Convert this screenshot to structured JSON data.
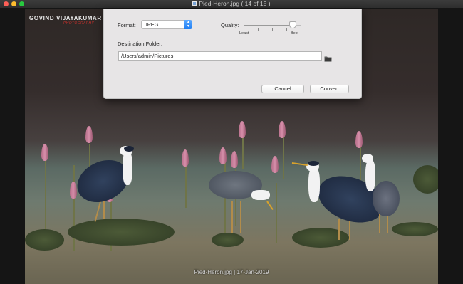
{
  "window": {
    "title": "Pied-Heron.jpg ( 14 of 15 )",
    "file_icon": "document-icon"
  },
  "photo": {
    "watermark_name": "GOVIND VIJAYAKUMAR",
    "watermark_sub": "PHOTOGRAPHY",
    "caption": "Pied-Heron.jpg | 17-Jan-2019"
  },
  "dialog": {
    "format_label": "Format:",
    "format_value": "JPEG",
    "quality_label": "Quality:",
    "quality_min_label": "Least",
    "quality_max_label": "Best",
    "quality_level": 0.85,
    "destination_label": "Destination Folder:",
    "destination_path": "/Users/admin/Pictures",
    "folder_button_icon": "folder-icon",
    "cancel_label": "Cancel",
    "convert_label": "Convert"
  }
}
